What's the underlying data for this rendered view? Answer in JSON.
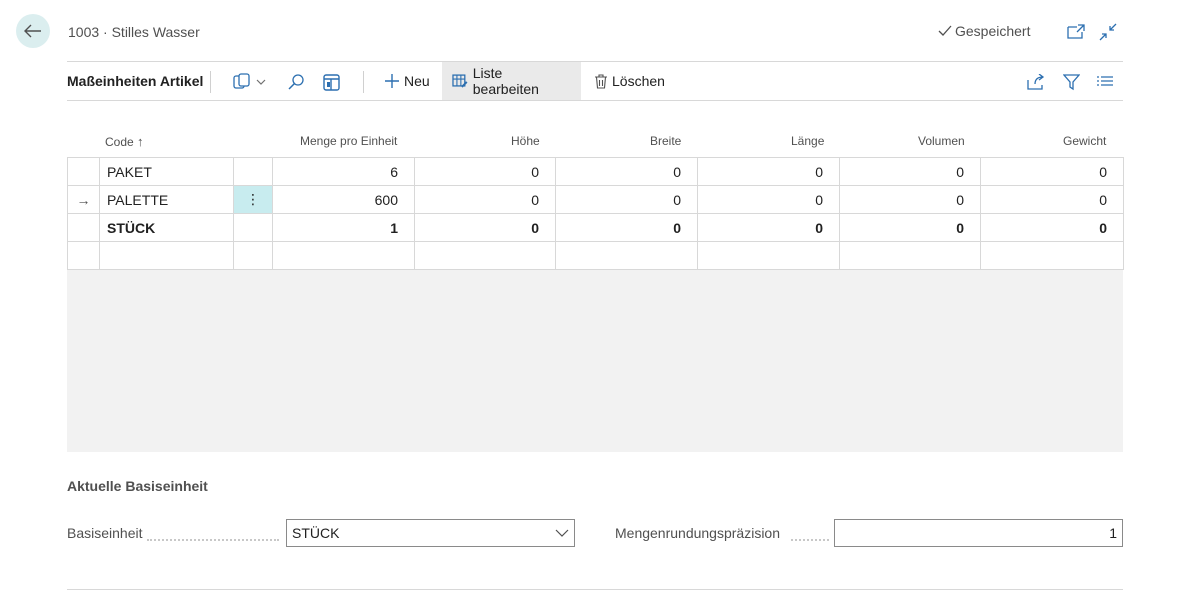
{
  "header": {
    "title": "1003 · Stilles Wasser",
    "saved_label": "Gespeichert"
  },
  "toolbar": {
    "title": "Maßeinheiten Artikel",
    "new_label": "Neu",
    "edit_list_label": "Liste bearbeiten",
    "delete_label": "Löschen"
  },
  "grid": {
    "columns": {
      "code": "Code",
      "qty_per_unit": "Menge pro Einheit",
      "height": "Höhe",
      "width": "Breite",
      "length": "Länge",
      "volume": "Volumen",
      "weight": "Gewicht"
    },
    "sort_indicator": "↑",
    "rows": [
      {
        "code": "PAKET",
        "qty": "6",
        "height": "0",
        "width": "0",
        "length": "0",
        "volume": "0",
        "weight": "0"
      },
      {
        "code": "PALETTE",
        "qty": "600",
        "height": "0",
        "width": "0",
        "length": "0",
        "volume": "0",
        "weight": "0"
      },
      {
        "code": "STÜCK",
        "qty": "1",
        "height": "0",
        "width": "0",
        "length": "0",
        "volume": "0",
        "weight": "0"
      }
    ],
    "row_indicator": "→",
    "menu_glyph": "⋮"
  },
  "base_unit": {
    "section_title": "Aktuelle Basiseinheit",
    "base_unit_label": "Basiseinheit",
    "base_unit_value": "STÜCK",
    "rounding_label": "Mengenrundungspräzision",
    "rounding_value": "1"
  },
  "colors": {
    "accent": "#008489",
    "selected_cell": "#c8ecef",
    "back_button": "#dbeeef"
  }
}
